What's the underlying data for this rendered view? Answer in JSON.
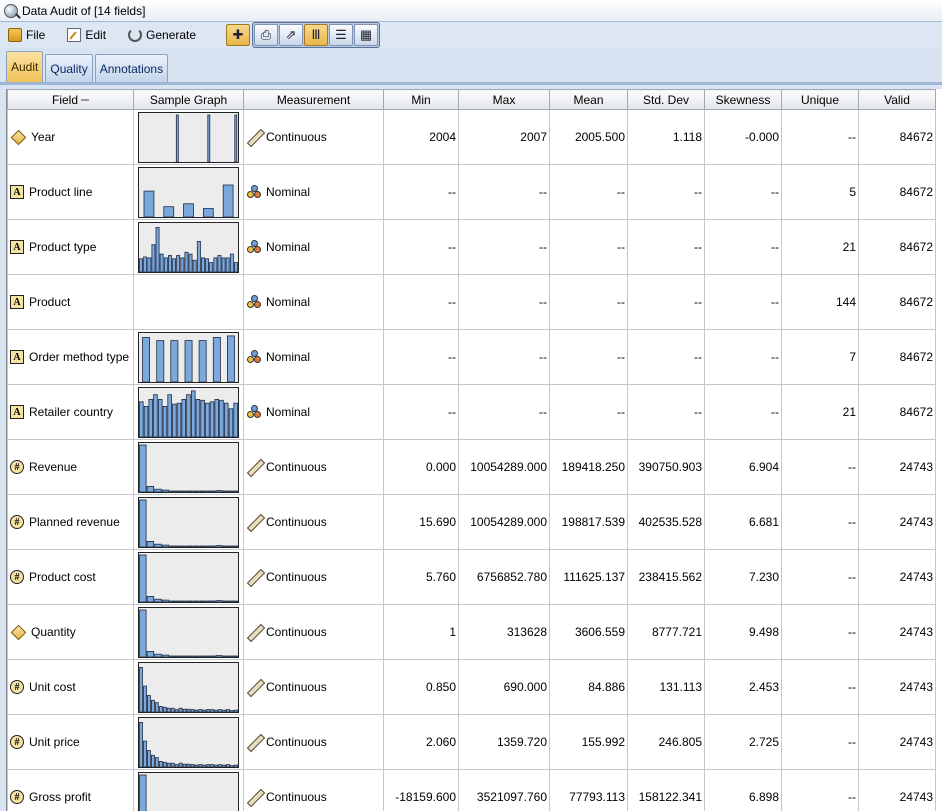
{
  "window": {
    "title": "Data Audit of [14 fields]"
  },
  "menu": [
    {
      "label": "File",
      "icon": "file-icon"
    },
    {
      "label": "Edit",
      "icon": "edit-icon"
    },
    {
      "label": "Generate",
      "icon": "generate-icon"
    }
  ],
  "toolbar": [
    {
      "icon": "generate-node-icon",
      "glyph": "✚",
      "active": true
    },
    {
      "icon": "print-icon",
      "glyph": "⎙",
      "active": false
    },
    {
      "icon": "export-icon",
      "glyph": "⇗",
      "active": false
    },
    {
      "icon": "columns-view-icon",
      "glyph": "Ⅲ",
      "active": true
    },
    {
      "icon": "list-view-icon",
      "glyph": "☰",
      "active": false
    },
    {
      "icon": "table-view-icon",
      "glyph": "▦",
      "active": false
    }
  ],
  "tabs": [
    {
      "label": "Audit",
      "active": true
    },
    {
      "label": "Quality",
      "active": false
    },
    {
      "label": "Annotations",
      "active": false
    }
  ],
  "table": {
    "columns": [
      "Field",
      "Sample Graph",
      "Measurement",
      "Min",
      "Max",
      "Mean",
      "Std. Dev",
      "Skewness",
      "Unique",
      "Valid"
    ],
    "rows": [
      {
        "field": "Year",
        "type": "diamond",
        "graph": "year",
        "measurement": "Continuous",
        "mtype": "cont",
        "min": "2004",
        "max": "2007",
        "mean": "2005.500",
        "std": "1.118",
        "skew": "-0.000",
        "unique": "--",
        "valid": "84672"
      },
      {
        "field": "Product line",
        "type": "text",
        "graph": "pl",
        "measurement": "Nominal",
        "mtype": "nom",
        "min": "--",
        "max": "--",
        "mean": "--",
        "std": "--",
        "skew": "--",
        "unique": "5",
        "valid": "84672"
      },
      {
        "field": "Product type",
        "type": "text",
        "graph": "pt",
        "measurement": "Nominal",
        "mtype": "nom",
        "min": "--",
        "max": "--",
        "mean": "--",
        "std": "--",
        "skew": "--",
        "unique": "21",
        "valid": "84672"
      },
      {
        "field": "Product",
        "type": "text",
        "graph": "none",
        "measurement": "Nominal",
        "mtype": "nom",
        "min": "--",
        "max": "--",
        "mean": "--",
        "std": "--",
        "skew": "--",
        "unique": "144",
        "valid": "84672"
      },
      {
        "field": "Order method type",
        "type": "text",
        "graph": "omt",
        "measurement": "Nominal",
        "mtype": "nom",
        "min": "--",
        "max": "--",
        "mean": "--",
        "std": "--",
        "skew": "--",
        "unique": "7",
        "valid": "84672"
      },
      {
        "field": "Retailer country",
        "type": "text",
        "graph": "rc",
        "measurement": "Nominal",
        "mtype": "nom",
        "min": "--",
        "max": "--",
        "mean": "--",
        "std": "--",
        "skew": "--",
        "unique": "21",
        "valid": "84672"
      },
      {
        "field": "Revenue",
        "type": "numeric",
        "graph": "skewA",
        "measurement": "Continuous",
        "mtype": "cont",
        "min": "0.000",
        "max": "10054289.000",
        "mean": "189418.250",
        "std": "390750.903",
        "skew": "6.904",
        "unique": "--",
        "valid": "24743"
      },
      {
        "field": "Planned revenue",
        "type": "numeric",
        "graph": "skewA",
        "measurement": "Continuous",
        "mtype": "cont",
        "min": "15.690",
        "max": "10054289.000",
        "mean": "198817.539",
        "std": "402535.528",
        "skew": "6.681",
        "unique": "--",
        "valid": "24743"
      },
      {
        "field": "Product cost",
        "type": "numeric",
        "graph": "skewA",
        "measurement": "Continuous",
        "mtype": "cont",
        "min": "5.760",
        "max": "6756852.780",
        "mean": "111625.137",
        "std": "238415.562",
        "skew": "7.230",
        "unique": "--",
        "valid": "24743"
      },
      {
        "field": "Quantity",
        "type": "diamond",
        "graph": "skewA",
        "measurement": "Continuous",
        "mtype": "cont",
        "min": "1",
        "max": "313628",
        "mean": "3606.559",
        "std": "8777.721",
        "skew": "9.498",
        "unique": "--",
        "valid": "24743"
      },
      {
        "field": "Unit cost",
        "type": "numeric",
        "graph": "skewB",
        "measurement": "Continuous",
        "mtype": "cont",
        "min": "0.850",
        "max": "690.000",
        "mean": "84.886",
        "std": "131.113",
        "skew": "2.453",
        "unique": "--",
        "valid": "24743"
      },
      {
        "field": "Unit price",
        "type": "numeric",
        "graph": "skewB",
        "measurement": "Continuous",
        "mtype": "cont",
        "min": "2.060",
        "max": "1359.720",
        "mean": "155.992",
        "std": "246.805",
        "skew": "2.725",
        "unique": "--",
        "valid": "24743"
      },
      {
        "field": "Gross profit",
        "type": "numeric",
        "graph": "skewA",
        "measurement": "Continuous",
        "mtype": "cont",
        "min": "-18159.600",
        "max": "3521097.760",
        "mean": "77793.113",
        "std": "158122.341",
        "skew": "6.898",
        "unique": "--",
        "valid": "24743"
      }
    ]
  },
  "graphs": {
    "year": [
      0,
      0,
      0,
      0,
      0,
      0,
      0,
      0,
      1,
      0,
      0,
      0,
      0,
      0,
      0,
      1,
      0,
      0,
      0,
      0,
      0,
      1
    ],
    "pl": [
      0.55,
      0.22,
      0.28,
      0.18,
      0.68
    ],
    "pt": [
      0.28,
      0.32,
      0.3,
      0.58,
      0.95,
      0.38,
      0.3,
      0.35,
      0.28,
      0.35,
      0.3,
      0.42,
      0.38,
      0.25,
      0.65,
      0.3,
      0.28,
      0.2,
      0.3,
      0.35,
      0.3,
      0.3,
      0.38,
      0.2
    ],
    "omt": [
      0.95,
      0.88,
      0.88,
      0.88,
      0.88,
      0.95,
      0.98
    ],
    "rc": [
      0.75,
      0.65,
      0.8,
      0.9,
      0.8,
      0.65,
      0.9,
      0.7,
      0.72,
      0.8,
      0.9,
      0.98,
      0.8,
      0.78,
      0.72,
      0.75,
      0.8,
      0.78,
      0.72,
      0.6,
      0.72
    ],
    "skewA": [
      1.0,
      0.12,
      0.06,
      0.04,
      0.02,
      0.015,
      0.01,
      0.008,
      0.005,
      0.004,
      0.03,
      0.003,
      0.002
    ],
    "skewB": [
      0.95,
      0.55,
      0.35,
      0.25,
      0.2,
      0.12,
      0.1,
      0.08,
      0.08,
      0.05,
      0.08,
      0.06,
      0.06,
      0.05,
      0.04,
      0.05,
      0.04,
      0.05,
      0.05,
      0.04,
      0.05,
      0.04,
      0.05,
      0.03,
      0.04
    ]
  }
}
